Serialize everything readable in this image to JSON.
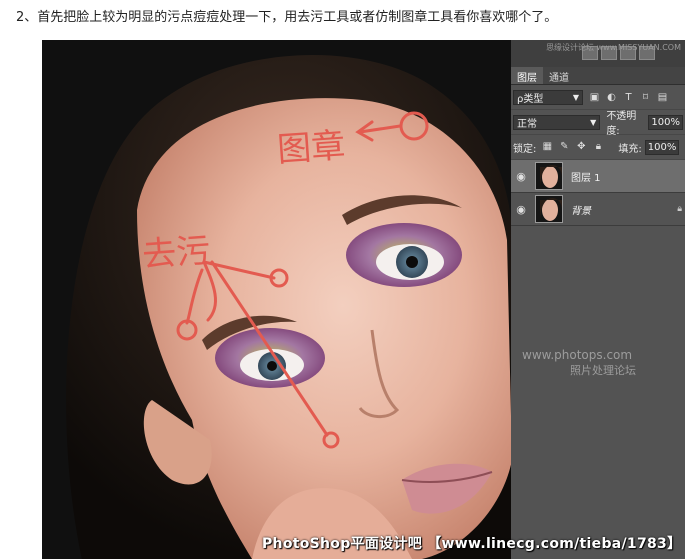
{
  "caption": "2、首先把脸上较为明显的污点痘痘处理一下，用去污工具或者仿制图章工具看你喜欢哪个了。",
  "canvas": {
    "annotations": {
      "stamp_label": "图章",
      "heal_label": "去污"
    },
    "bottom_watermark": "PhotoShop平面设计吧 【www.linecg.com/tieba/1783】"
  },
  "panel": {
    "top_watermark": "思缘设计论坛 www.MISSYUAN.COM",
    "tabs": [
      {
        "label": "图层",
        "active": true
      },
      {
        "label": "通道",
        "active": false
      }
    ],
    "filter": {
      "value": "ρ类型",
      "icons": [
        "image-filter-icon",
        "adjustment-filter-icon",
        "type-filter-icon",
        "shape-filter-icon",
        "smart-object-filter-icon"
      ]
    },
    "blend": {
      "mode": "正常",
      "opacity_label": "不透明度:",
      "opacity_value": "100%"
    },
    "lock": {
      "label": "锁定:",
      "fill_label": "填充:",
      "fill_value": "100%"
    },
    "layers": [
      {
        "name": "图层 1",
        "selected": true,
        "italic": false,
        "locked": false
      },
      {
        "name": "背景",
        "selected": false,
        "italic": true,
        "locked": true
      }
    ],
    "watermark_line1": "www.photops.com",
    "watermark_line2": "照片处理论坛"
  },
  "colors": {
    "annotation": "#e35b50",
    "panel": "#535353",
    "selected_layer": "#6e6e6e"
  }
}
